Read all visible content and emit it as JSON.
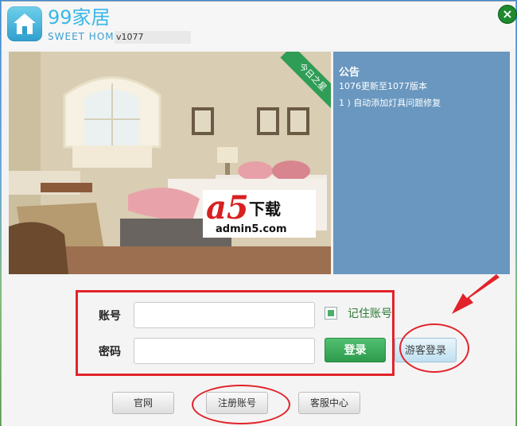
{
  "app": {
    "logo_text": "99家居",
    "logo_subtitle": "SWEET HOME",
    "version": "v1077",
    "close_symbol": "×"
  },
  "banner": {
    "ribbon_label": "今日之星",
    "watermark_title": "下载",
    "watermark_logo": "a5",
    "watermark_url": "admin5.com"
  },
  "notice": {
    "title": "公告",
    "lines": [
      "1076更新至1077版本",
      "1 ) 自动添加灯具问题修复"
    ]
  },
  "login": {
    "account_label": "账号",
    "password_label": "密码",
    "account_value": "",
    "password_value": "",
    "remember_label": "记住账号",
    "remember_checked": true,
    "login_button": "登录",
    "guest_button": "游客登录"
  },
  "footer": {
    "website_button": "官网",
    "register_button": "注册账号",
    "support_button": "客服中心"
  },
  "colors": {
    "accent_green": "#2d9a4c",
    "notice_bg": "#6997bf",
    "annotation_red": "#e2232a"
  }
}
